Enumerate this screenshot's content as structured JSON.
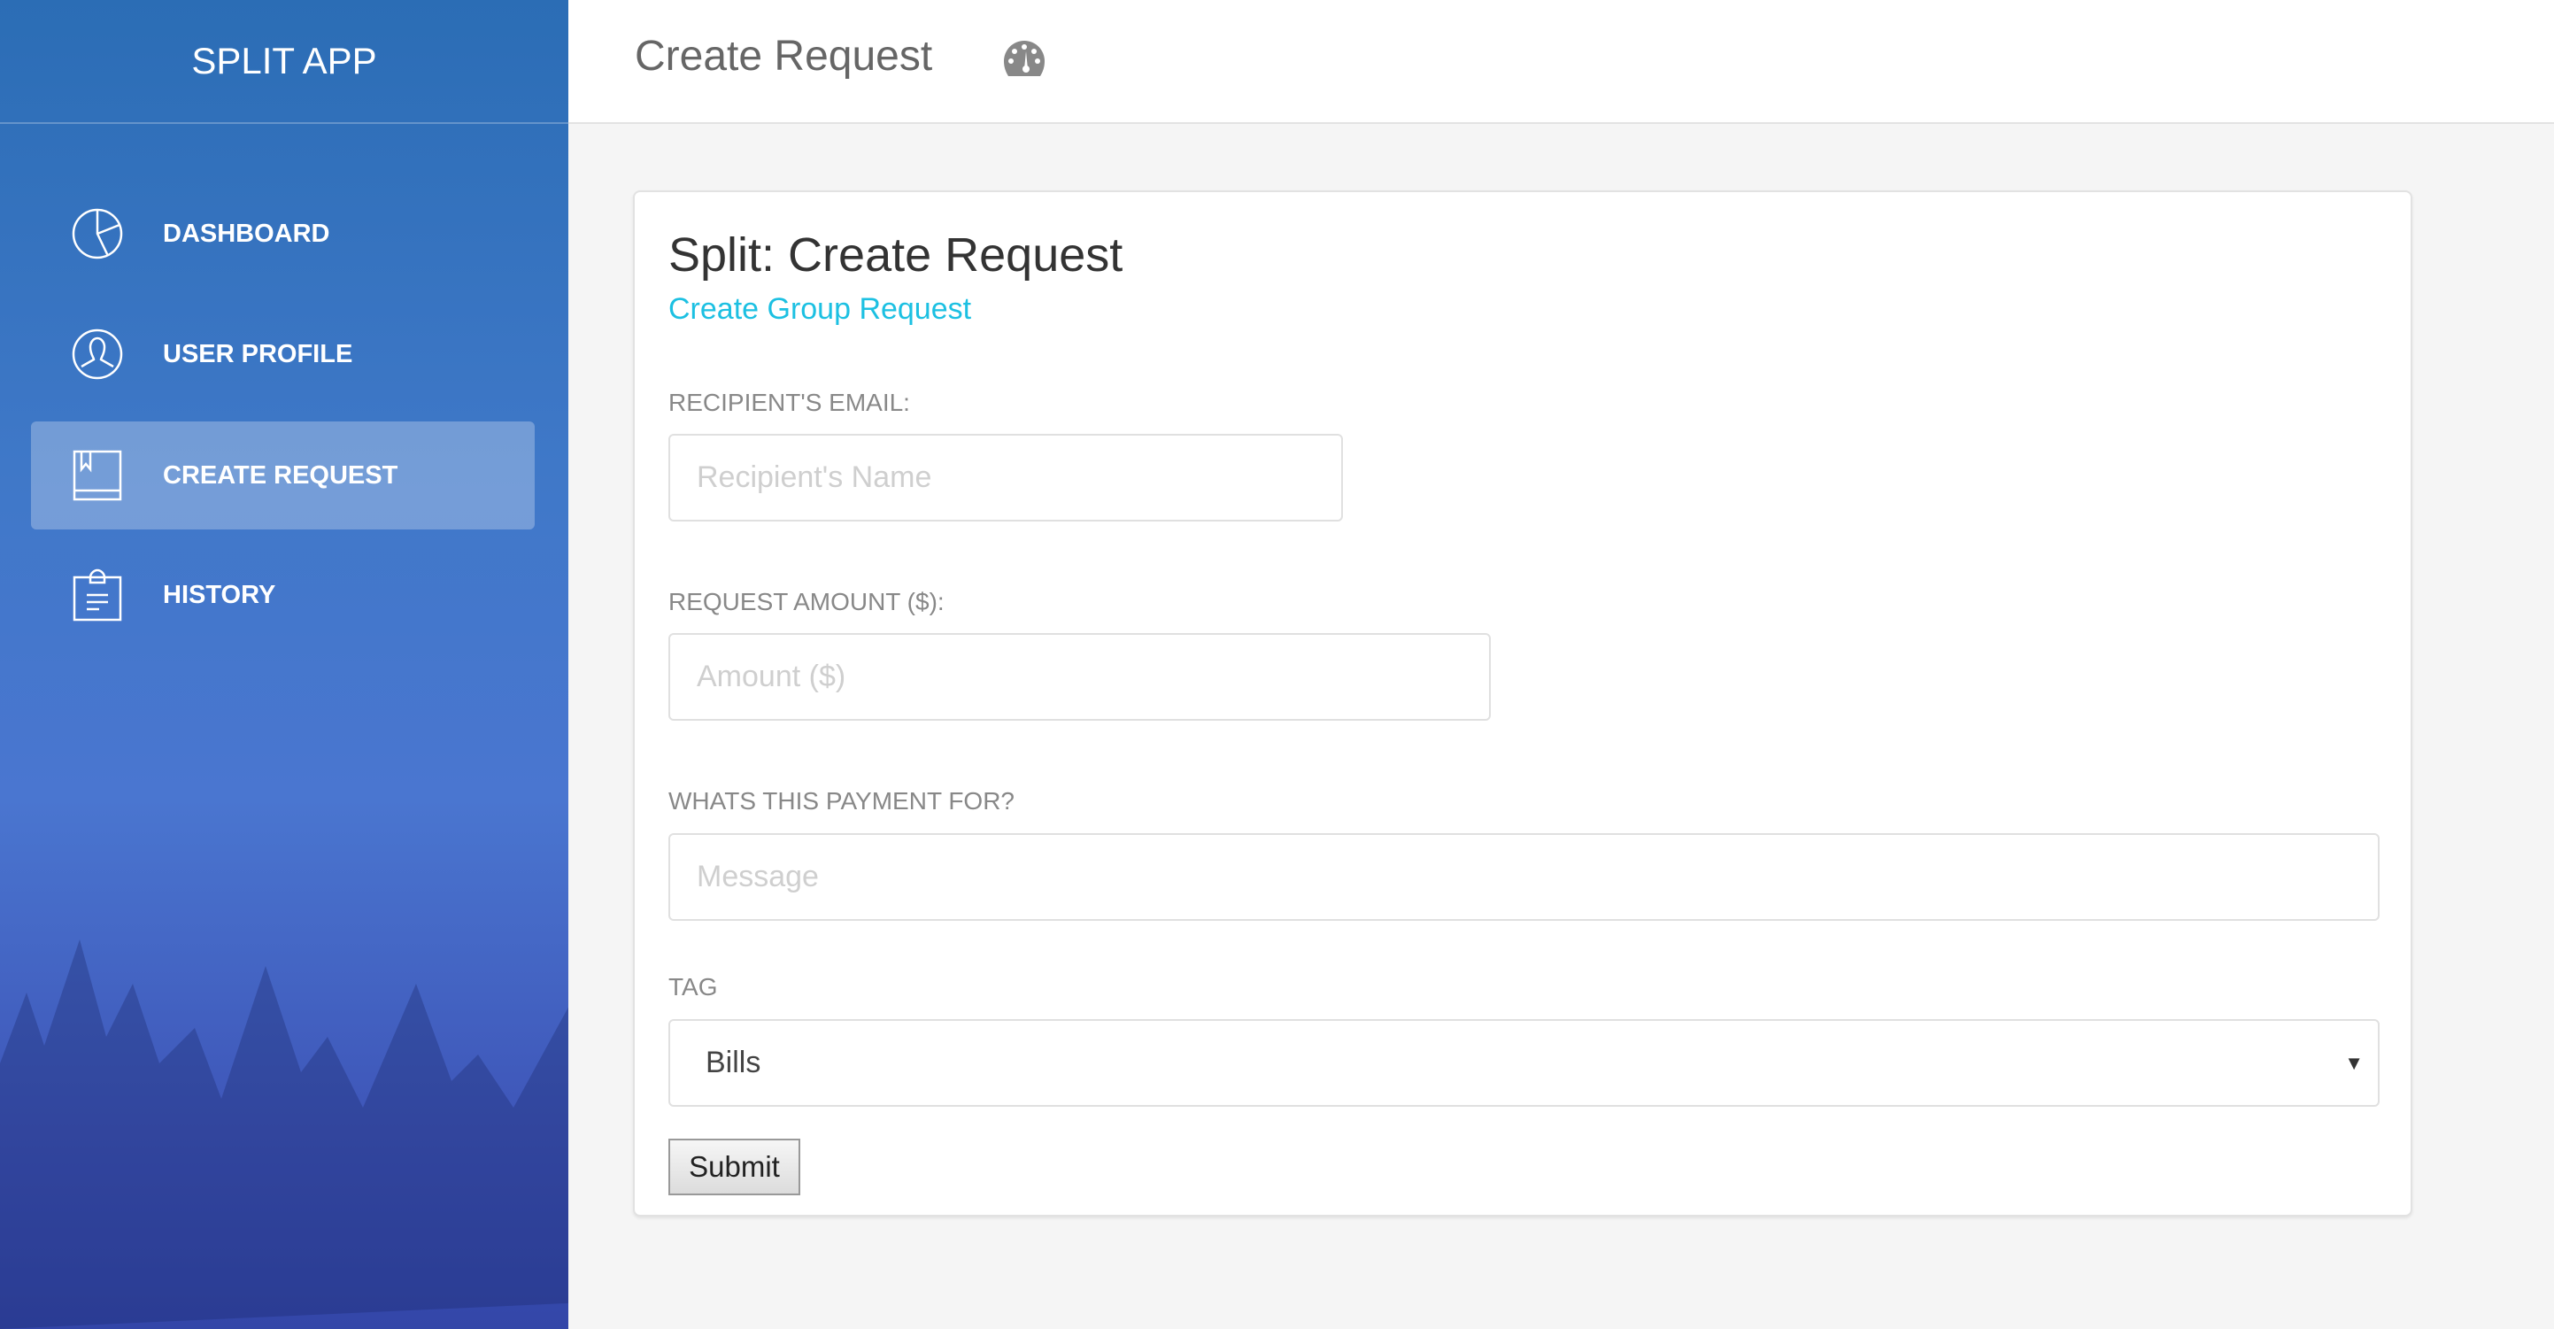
{
  "sidebar": {
    "brand": "SPLIT APP",
    "items": [
      {
        "label": "DASHBOARD",
        "icon": "pie-chart-icon"
      },
      {
        "label": "USER PROFILE",
        "icon": "user-icon"
      },
      {
        "label": "CREATE REQUEST",
        "icon": "book-icon",
        "active": true
      },
      {
        "label": "HISTORY",
        "icon": "clipboard-icon"
      }
    ]
  },
  "header": {
    "title": "Create Request",
    "icon": "dashboard-gauge-icon"
  },
  "form": {
    "title": "Split: Create Request",
    "group_link": "Create Group Request",
    "email_label": "RECIPIENT'S EMAIL:",
    "email_placeholder": "Recipient's Name",
    "amount_label": "REQUEST AMOUNT ($):",
    "amount_placeholder": "Amount ($)",
    "message_label": "WHATS THIS PAYMENT FOR?",
    "message_placeholder": "Message",
    "tag_label": "TAG",
    "tag_value": "Bills",
    "submit": "Submit"
  },
  "colors": {
    "accent": "#1cc0e2",
    "sidebar": "#3f78c8"
  }
}
